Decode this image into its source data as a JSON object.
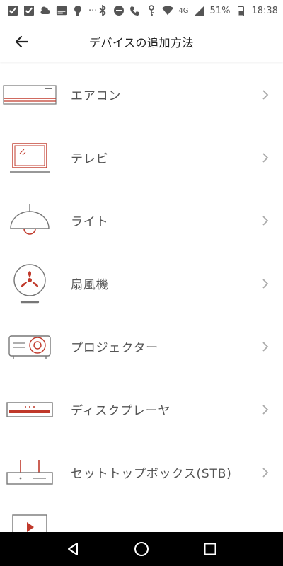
{
  "status_bar": {
    "icons_left": [
      "checkbox-notification-icon",
      "checkbox-notification-icon",
      "weather-icon",
      "au-pay-icon",
      "usb-debug-icon",
      "more-icon"
    ],
    "icons_right": [
      "bluetooth-icon",
      "dnd-icon",
      "4g-call-icon",
      "key-icon",
      "wifi-icon",
      "signal-icon"
    ],
    "more_label": "···",
    "network_label": "4G",
    "battery": "51%",
    "time": "18:38"
  },
  "app_bar": {
    "title": "デバイスの追加方法",
    "back_icon": "arrow-left-icon"
  },
  "colors": {
    "accent": "#c0392b",
    "icon_gray": "#777777",
    "text": "#555555",
    "chevron": "#aaaaaa"
  },
  "devices": [
    {
      "label": "エアコン",
      "icon": "air-conditioner-icon"
    },
    {
      "label": "テレビ",
      "icon": "tv-icon"
    },
    {
      "label": "ライト",
      "icon": "light-icon"
    },
    {
      "label": "扇風機",
      "icon": "fan-icon"
    },
    {
      "label": "プロジェクター",
      "icon": "projector-icon"
    },
    {
      "label": "ディスクプレーヤ",
      "icon": "disc-player-icon"
    },
    {
      "label": "セットトップボックス(STB)",
      "icon": "set-top-box-icon"
    },
    {
      "label": "",
      "icon": "media-icon"
    }
  ],
  "nav": [
    "back-triangle-icon",
    "home-circle-icon",
    "recents-square-icon"
  ]
}
